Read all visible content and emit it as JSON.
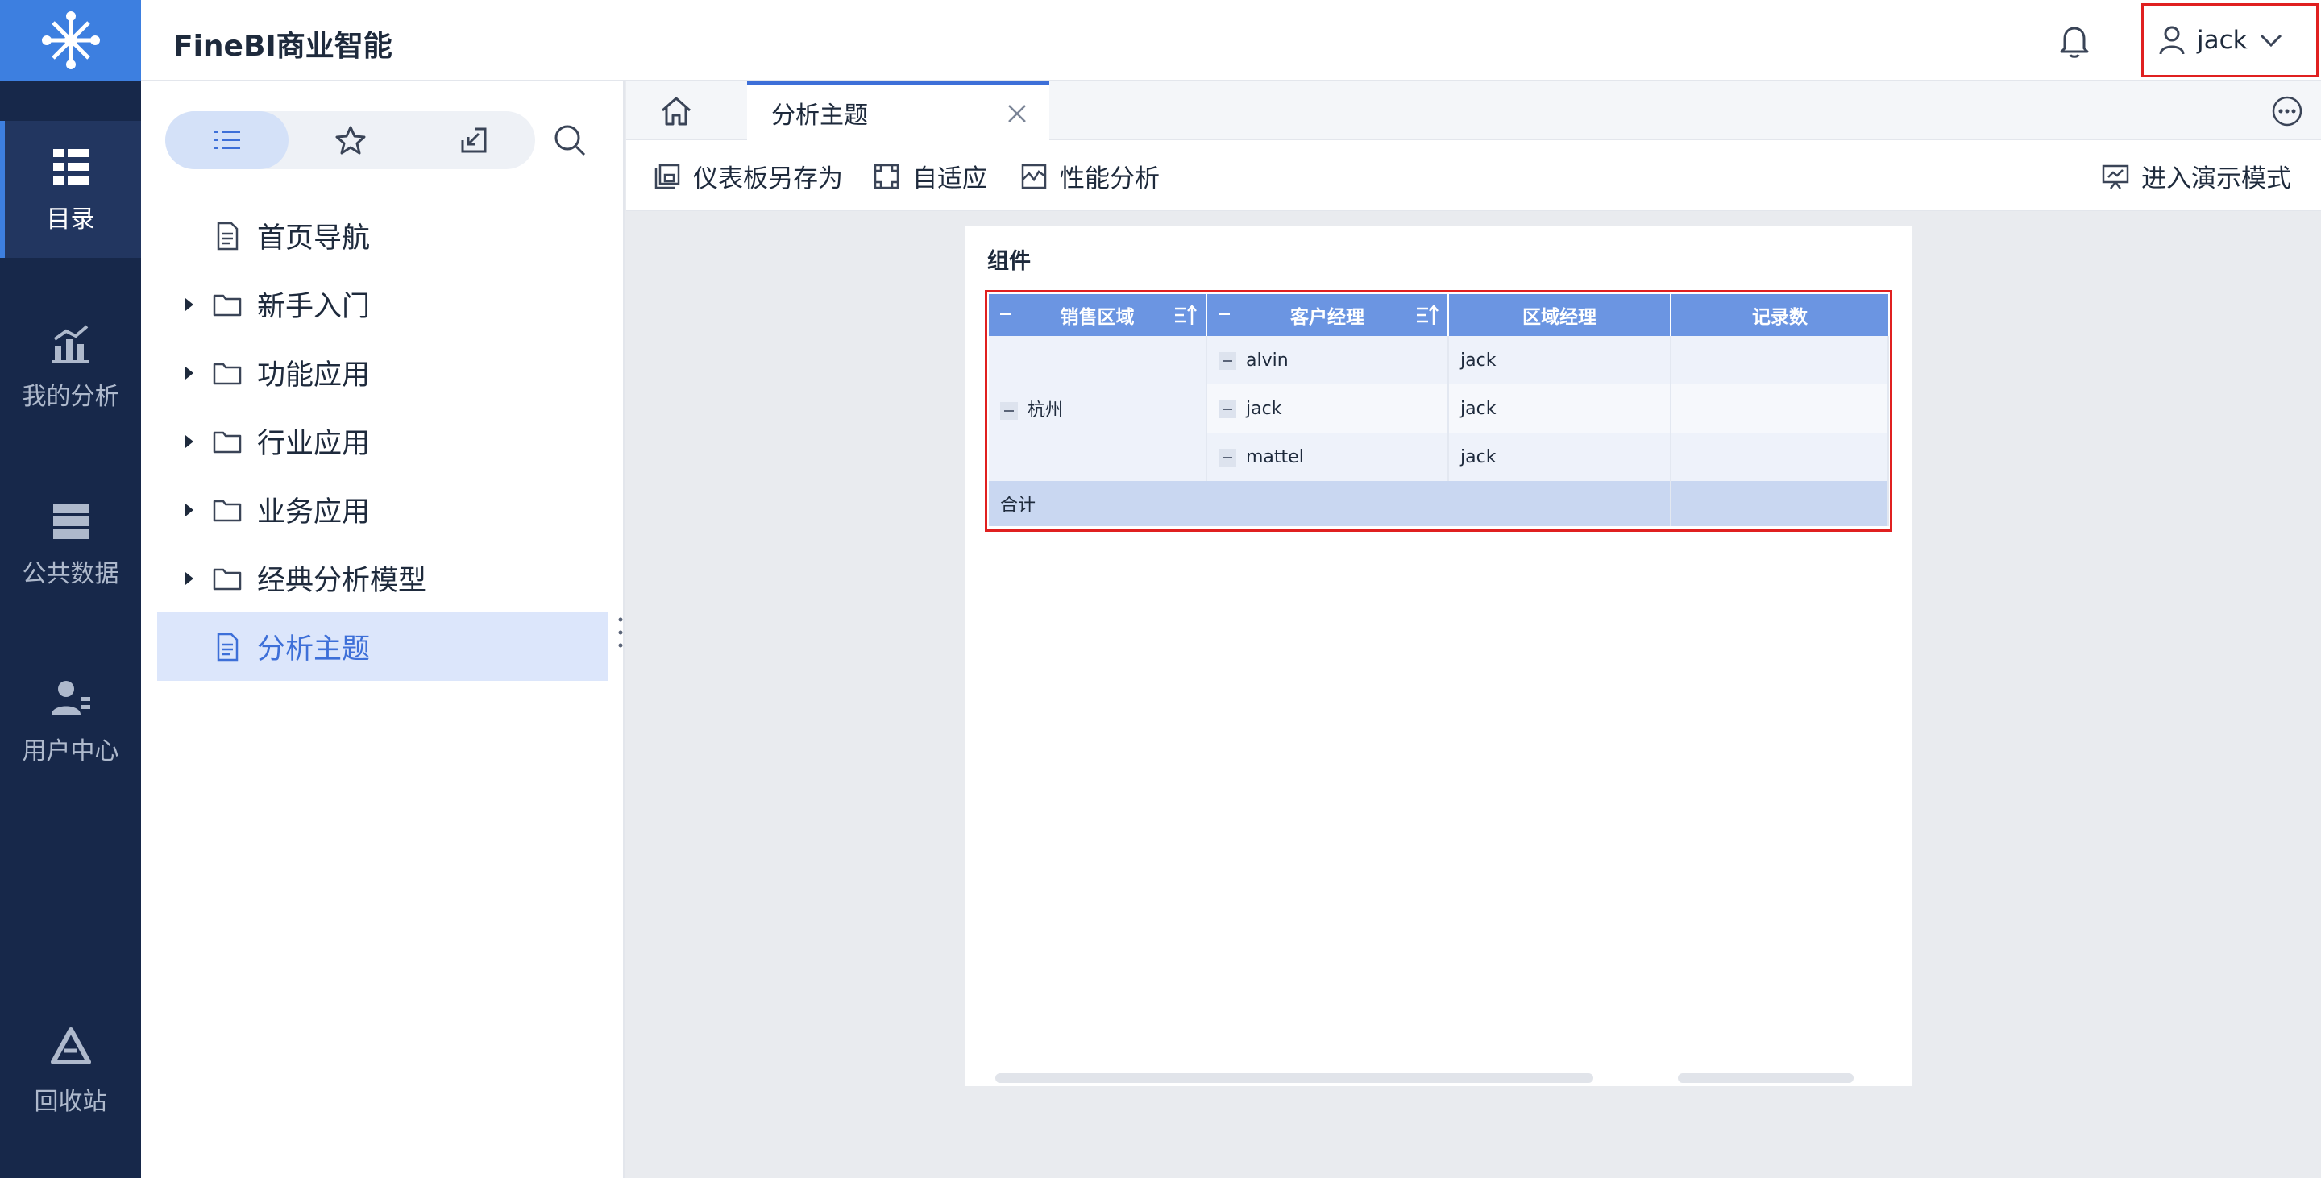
{
  "app": {
    "brand": "FineBI商业智能"
  },
  "rail": {
    "items": [
      {
        "label": "目录",
        "icon": "catalog-icon",
        "active": true
      },
      {
        "label": "我的分析",
        "icon": "analysis-icon",
        "active": false
      },
      {
        "label": "公共数据",
        "icon": "database-icon",
        "active": false
      },
      {
        "label": "用户中心",
        "icon": "user-center-icon",
        "active": false
      },
      {
        "label": "回收站",
        "icon": "recycle-bin-icon",
        "active": false
      }
    ]
  },
  "header": {
    "username": "jack"
  },
  "directory": {
    "segments": [
      {
        "icon": "list-icon",
        "active": true
      },
      {
        "icon": "star-icon",
        "active": false
      },
      {
        "icon": "import-icon",
        "active": false
      }
    ],
    "items": [
      {
        "label": "首页导航",
        "type": "file",
        "expandable": false,
        "selected": false
      },
      {
        "label": "新手入门",
        "type": "folder",
        "expandable": true,
        "selected": false
      },
      {
        "label": "功能应用",
        "type": "folder",
        "expandable": true,
        "selected": false
      },
      {
        "label": "行业应用",
        "type": "folder",
        "expandable": true,
        "selected": false
      },
      {
        "label": "业务应用",
        "type": "folder",
        "expandable": true,
        "selected": false
      },
      {
        "label": "经典分析模型",
        "type": "folder",
        "expandable": true,
        "selected": false
      },
      {
        "label": "分析主题",
        "type": "file",
        "expandable": false,
        "selected": true
      }
    ]
  },
  "tabs": {
    "active_label": "分析主题"
  },
  "toolbar": {
    "save_as": "仪表板另存为",
    "adaptive": "自适应",
    "performance": "性能分析",
    "presentation": "进入演示模式"
  },
  "component": {
    "title": "组件",
    "columns": [
      "销售区域",
      "客户经理",
      "区域经理",
      "记录数"
    ],
    "region": "杭州",
    "rows": [
      {
        "manager": "alvin",
        "region_manager": "jack",
        "count": ""
      },
      {
        "manager": "jack",
        "region_manager": "jack",
        "count": ""
      },
      {
        "manager": "mattel",
        "region_manager": "jack",
        "count": ""
      }
    ],
    "total_label": "合计"
  },
  "colors": {
    "rail_bg": "#17284a",
    "accent": "#3d6fd8",
    "header_cell": "#6b95e2",
    "highlight": "#e02020"
  }
}
